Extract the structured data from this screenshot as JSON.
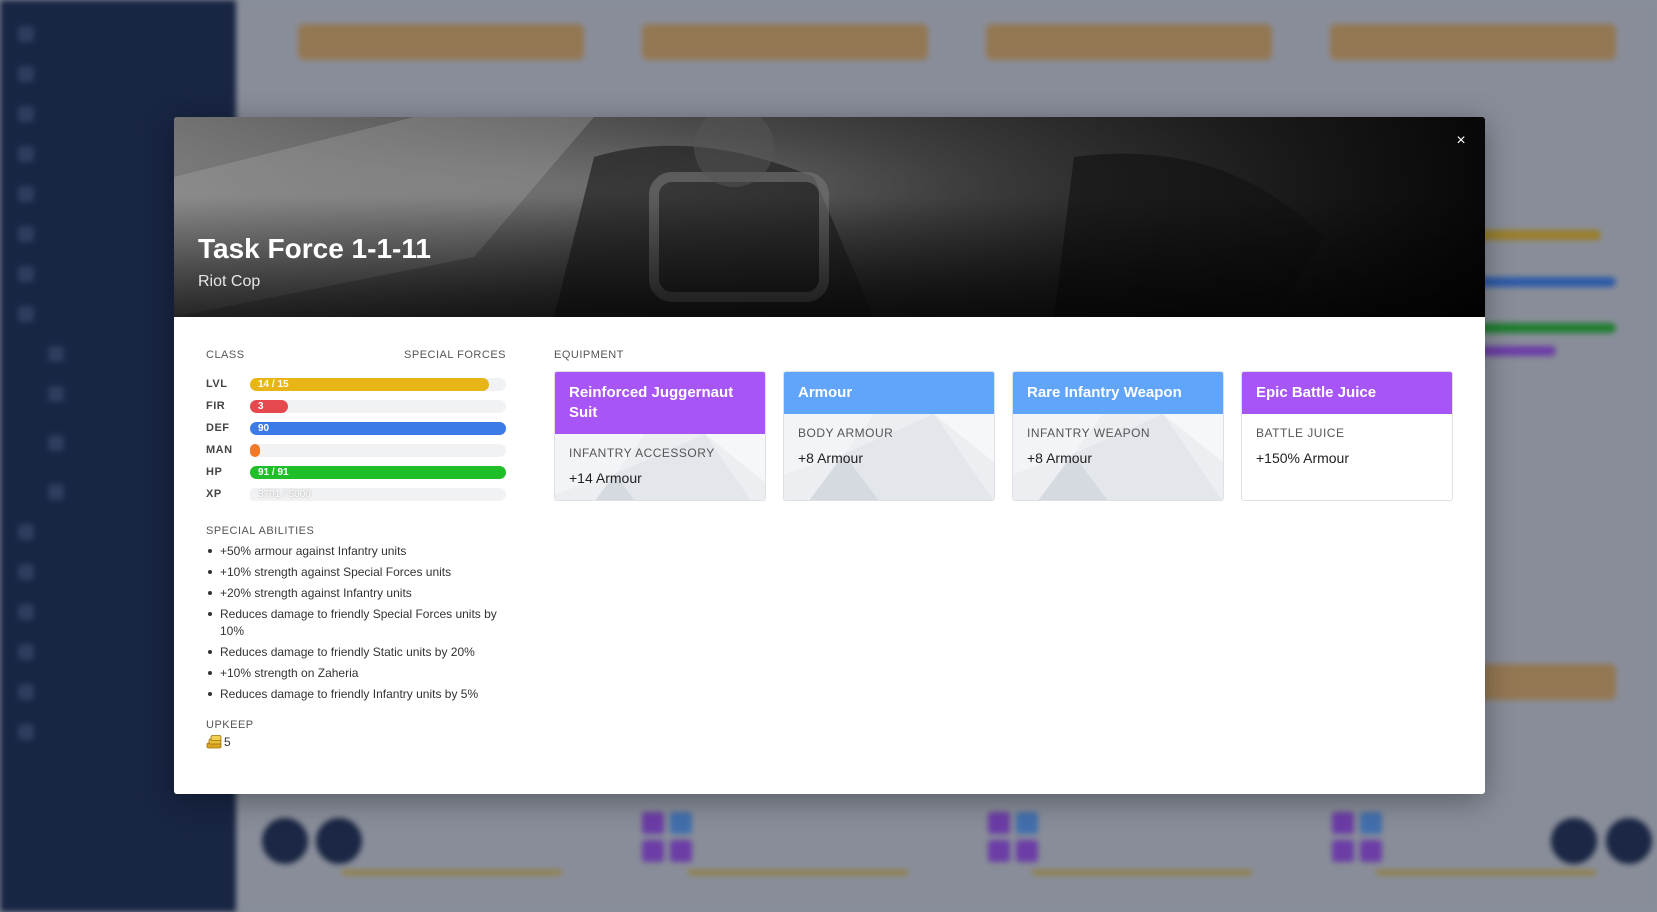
{
  "unit": {
    "name": "Task Force 1-1-11",
    "type": "Riot Cop",
    "class_label": "CLASS",
    "class_value": "SPECIAL FORCES"
  },
  "stats": [
    {
      "label": "LVL",
      "value": "14 / 15",
      "fraction": 0.933,
      "color": "#e8b516"
    },
    {
      "label": "FIR",
      "value": "3",
      "fraction": 0.15,
      "color": "#e5484d"
    },
    {
      "label": "DEF",
      "value": "90",
      "fraction": 1.0,
      "color": "#3b7be8"
    },
    {
      "label": "MAN",
      "value": "",
      "fraction": 0.04,
      "color": "#f07a2a"
    },
    {
      "label": "HP",
      "value": "91 / 91",
      "fraction": 1.0,
      "color": "#1fbf2a"
    },
    {
      "label": "XP",
      "value": "3701 / 5000",
      "fraction": 0.0,
      "color": "#f1f2f4"
    }
  ],
  "abilities": {
    "label": "SPECIAL ABILITIES",
    "items": [
      "+50% armour against Infantry units",
      "+10% strength against Special Forces units",
      "+20% strength against Infantry units",
      "Reduces damage to friendly Special Forces units by 10%",
      "Reduces damage to friendly Static units by 20%",
      "+10% strength on Zaheria",
      "Reduces damage to friendly Infantry units by 5%"
    ]
  },
  "upkeep": {
    "label": "UPKEEP",
    "value": "5"
  },
  "equipment": {
    "label": "EQUIPMENT",
    "cards": [
      {
        "name": "Reinforced Juggernaut Suit",
        "type": "INFANTRY ACCESSORY",
        "stat": "+14 Armour",
        "color": "#a855f7",
        "pattern": true
      },
      {
        "name": "Armour",
        "type": "BODY ARMOUR",
        "stat": "+8 Armour",
        "color": "#60a5fa",
        "pattern": true
      },
      {
        "name": "Rare Infantry Weapon",
        "type": "INFANTRY WEAPON",
        "stat": "+8 Armour",
        "color": "#60a5fa",
        "pattern": true
      },
      {
        "name": "Epic Battle Juice",
        "type": "BATTLE JUICE",
        "stat": "+150% Armour",
        "color": "#a855f7",
        "pattern": false
      }
    ]
  },
  "close_label": "×"
}
